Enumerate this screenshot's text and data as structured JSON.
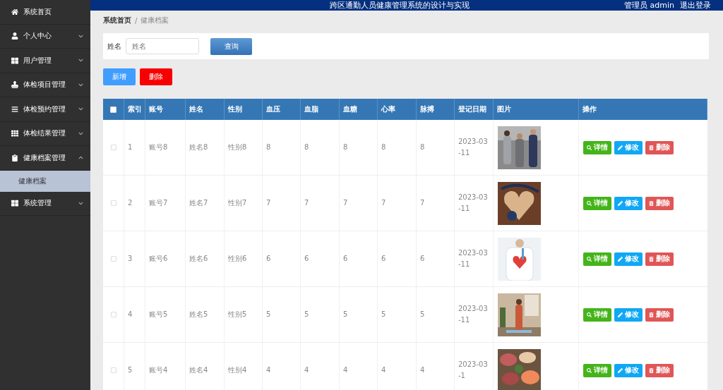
{
  "sidebar": {
    "items": [
      {
        "label": "系统首页"
      },
      {
        "label": "个人中心",
        "expanded": false
      },
      {
        "label": "用户管理",
        "expanded": false
      },
      {
        "label": "体检项目管理",
        "expanded": false
      },
      {
        "label": "体检预约管理",
        "expanded": false
      },
      {
        "label": "体检结果管理",
        "expanded": false
      },
      {
        "label": "健康档案管理",
        "expanded": true,
        "children": [
          {
            "label": "健康档案",
            "selected": true
          }
        ]
      },
      {
        "label": "系统管理",
        "expanded": false
      }
    ]
  },
  "header": {
    "title": "跨区通勤人员健康管理系统的设计与实现",
    "user": "管理员 admin",
    "logout": "退出登录"
  },
  "breadcrumb": [
    "系统首页",
    "健康档案"
  ],
  "breadcrumb_separator": "/",
  "search": {
    "label": "姓名",
    "placeholder": "姓名",
    "button": "查询"
  },
  "actions": {
    "add": "新增",
    "delete": "删除"
  },
  "table": {
    "columns": [
      "索引",
      "账号",
      "姓名",
      "性别",
      "血压",
      "血脂",
      "血糖",
      "心率",
      "脉搏",
      "登记日期",
      "图片",
      "操作"
    ],
    "header_checkbox_checked": false,
    "rows": [
      {
        "cells": [
          "1",
          "账号8",
          "姓名8",
          "性别8",
          "8",
          "8",
          "8",
          "8",
          "8",
          "2023-03-11"
        ],
        "checked": false,
        "actions": [
          "详情",
          "修改",
          "删除"
        ]
      },
      {
        "cells": [
          "2",
          "账号7",
          "姓名7",
          "性别7",
          "7",
          "7",
          "7",
          "7",
          "7",
          "2023-03-11"
        ],
        "checked": false,
        "actions": [
          "详情",
          "修改",
          "删除"
        ]
      },
      {
        "cells": [
          "3",
          "账号6",
          "姓名6",
          "性别6",
          "6",
          "6",
          "6",
          "6",
          "6",
          "2023-03-11"
        ],
        "checked": false,
        "actions": [
          "详情",
          "修改",
          "删除"
        ]
      },
      {
        "cells": [
          "4",
          "账号5",
          "姓名5",
          "性别5",
          "5",
          "5",
          "5",
          "5",
          "5",
          "2023-03-11"
        ],
        "checked": false,
        "actions": [
          "详情",
          "修改",
          "删除"
        ]
      },
      {
        "cells": [
          "5",
          "账号4",
          "姓名4",
          "性别4",
          "4",
          "4",
          "4",
          "4",
          "4",
          "2023-03-1"
        ],
        "checked": false,
        "actions": [
          "详情",
          "修改",
          "删除"
        ]
      }
    ]
  }
}
